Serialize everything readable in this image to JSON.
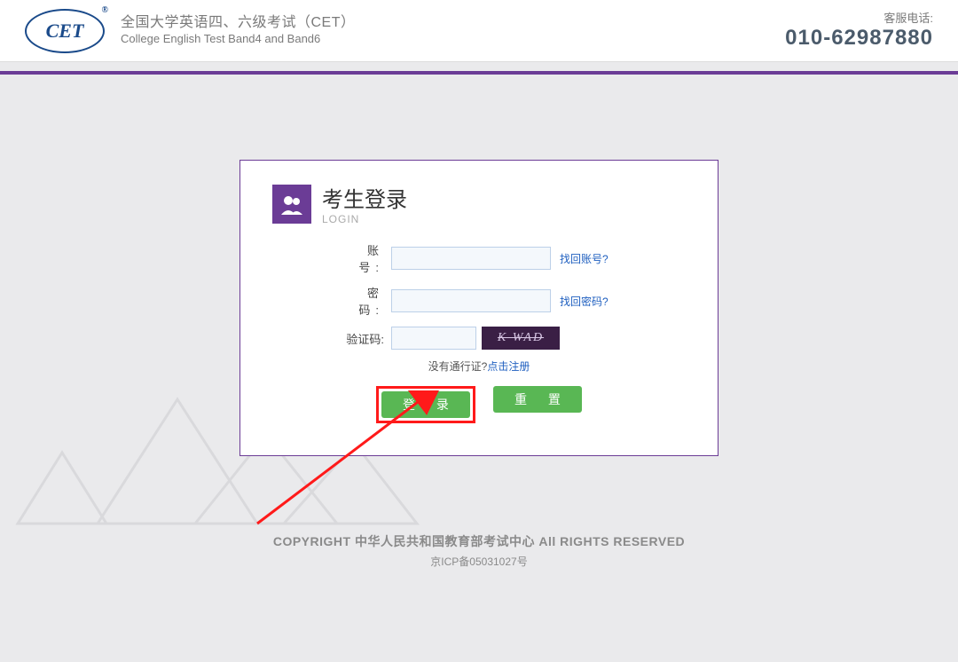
{
  "header": {
    "logo_text": "CET",
    "title_cn": "全国大学英语四、六级考试（CET）",
    "title_en": "College English Test Band4 and Band6",
    "service_label": "客服电话:",
    "service_phone": "010-62987880"
  },
  "login": {
    "title_cn": "考生登录",
    "title_en": "LOGIN",
    "fields": {
      "account_label": "账 号:",
      "account_value": "",
      "account_recover": "找回账号?",
      "password_label": "密 码:",
      "password_value": "",
      "password_recover": "找回密码?",
      "captcha_label": "验证码:",
      "captcha_value": "",
      "captcha_text": "K WAD"
    },
    "register_prompt": "没有通行证?",
    "register_link": "点击注册",
    "login_btn": "登 录",
    "reset_btn": "重 置"
  },
  "footer": {
    "line1": "COPYRIGHT 中华人民共和国教育部考试中心 All RIGHTS RESERVED",
    "line2": "京ICP备05031027号"
  }
}
